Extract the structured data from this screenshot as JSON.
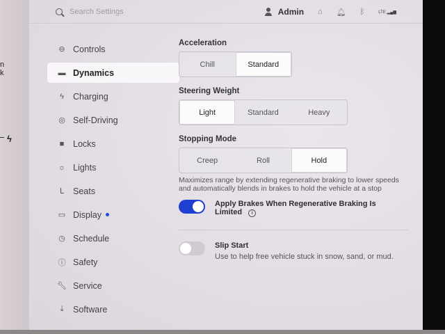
{
  "left_fragments": [
    "n",
    "k"
  ],
  "topbar": {
    "search_placeholder": "Search Settings",
    "user_label": "Admin",
    "signal_label": "LTE"
  },
  "sidebar": {
    "items": [
      {
        "label": "Controls",
        "icon": "toggle-icon"
      },
      {
        "label": "Dynamics",
        "icon": "car-icon",
        "active": true
      },
      {
        "label": "Charging",
        "icon": "bolt-icon"
      },
      {
        "label": "Self-Driving",
        "icon": "steering-wheel-icon"
      },
      {
        "label": "Locks",
        "icon": "lock-icon"
      },
      {
        "label": "Lights",
        "icon": "sun-icon"
      },
      {
        "label": "Seats",
        "icon": "seat-icon"
      },
      {
        "label": "Display",
        "icon": "display-icon"
      },
      {
        "label": "Schedule",
        "icon": "clock-icon"
      },
      {
        "label": "Safety",
        "icon": "alert-icon"
      },
      {
        "label": "Service",
        "icon": "wrench-icon"
      },
      {
        "label": "Software",
        "icon": "download-icon"
      }
    ]
  },
  "main": {
    "acceleration": {
      "label": "Acceleration",
      "options": [
        "Chill",
        "Standard"
      ],
      "selected": "Standard"
    },
    "steering": {
      "label": "Steering Weight",
      "options": [
        "Light",
        "Standard",
        "Heavy"
      ],
      "selected": "Light"
    },
    "stopping": {
      "label": "Stopping Mode",
      "options": [
        "Creep",
        "Roll",
        "Hold"
      ],
      "selected": "Hold",
      "description": "Maximizes range by extending regenerative braking to lower speeds and automatically blends in brakes to hold the vehicle at a stop"
    },
    "apply_brakes": {
      "title": "Apply Brakes When Regenerative Braking Is Limited",
      "enabled": true
    },
    "slip_start": {
      "title": "Slip Start",
      "description": "Use to help free vehicle stuck in snow, sand, or mud.",
      "enabled": false
    }
  },
  "colors": {
    "accent": "#1f3fd0",
    "notification_dot": "#1f4ed8"
  }
}
